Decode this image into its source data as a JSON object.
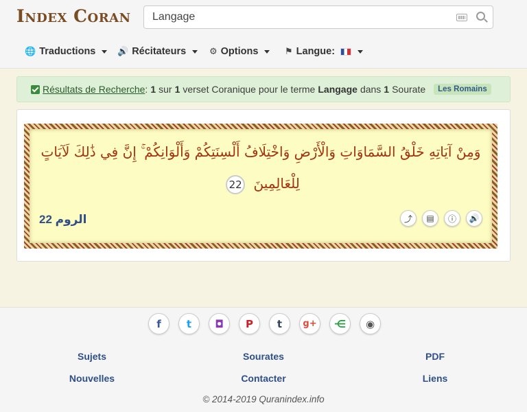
{
  "brand": {
    "logo_text": "Index Coran"
  },
  "search": {
    "value": "Langage"
  },
  "nav": {
    "translations": "Traductions",
    "reciters": "Récitateurs",
    "options": "Options",
    "language": "Langue:"
  },
  "alert": {
    "link": "Résultats de Recherche",
    "colon": ":",
    "count": "1",
    "sur": "sur",
    "total": "1",
    "verse_text": "verset Coranique pour le terme",
    "term": "Langage",
    "dans": "dans",
    "surah_count": "1",
    "surah_word": "Sourate",
    "badge": "Les Romains"
  },
  "verse": {
    "text": "وَمِنْ آيَاتِهِ خَلْقُ السَّمَاوَاتِ وَالْأَرْضِ وَاخْتِلَافُ أَلْسِنَتِكُمْ وَأَلْوَانِكُمْ ۚ إِنَّ فِي ذَٰلِكَ لَآيَاتٍ لِلْعَالِمِينَ",
    "number": "22",
    "reference": "الروم 22"
  },
  "footer": {
    "links": [
      "Sujets",
      "Sourates",
      "PDF",
      "Nouvelles",
      "Contacter",
      "Liens"
    ],
    "copyright": "© 2014-2019 Quranindex.info"
  },
  "colors": {
    "accent": "#2f4f86",
    "brand": "#7a4c24",
    "verse_text": "#a3320f"
  }
}
